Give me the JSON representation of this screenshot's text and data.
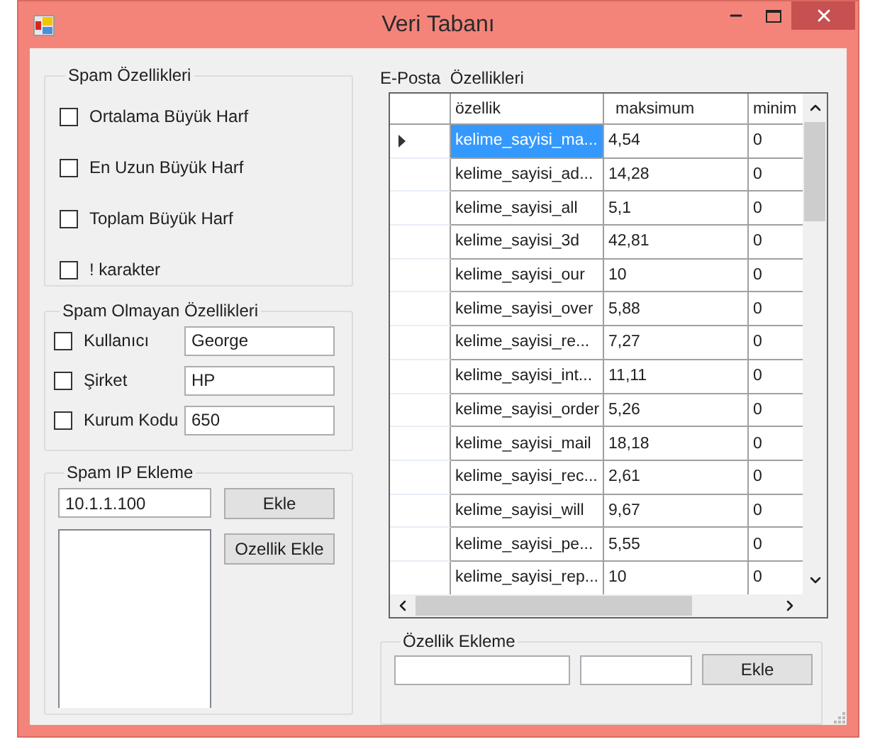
{
  "window": {
    "title": "Veri Tabanı"
  },
  "spam_features": {
    "title": "Spam Özellikleri",
    "options": [
      {
        "label": "Ortalama Büyük Harf",
        "checked": false
      },
      {
        "label": "En Uzun Büyük Harf",
        "checked": false
      },
      {
        "label": "Toplam Büyük Harf",
        "checked": false
      },
      {
        "label": "! karakter",
        "checked": false
      }
    ]
  },
  "non_spam_features": {
    "title": "Spam Olmayan Özellikleri",
    "fields": [
      {
        "label": "Kullanıcı",
        "checked": false,
        "value": "George"
      },
      {
        "label": "Şirket",
        "checked": false,
        "value": "HP"
      },
      {
        "label": "Kurum Kodu",
        "checked": false,
        "value": "650"
      }
    ]
  },
  "spam_ip": {
    "title": "Spam IP Ekleme",
    "value": "10.1.1.100",
    "add_button": "Ekle",
    "feature_button": "Ozellik Ekle"
  },
  "email_features": {
    "title": "E-Posta  Özellikleri",
    "columns": [
      "özellik",
      "maksimum",
      "minim"
    ],
    "rows": [
      {
        "cells": [
          "kelime_sayisi_ma...",
          "4,54",
          "0"
        ],
        "selected": true
      },
      {
        "cells": [
          "kelime_sayisi_ad...",
          "14,28",
          "0"
        ],
        "selected": false
      },
      {
        "cells": [
          "kelime_sayisi_all",
          "5,1",
          "0"
        ],
        "selected": false
      },
      {
        "cells": [
          "kelime_sayisi_3d",
          "42,81",
          "0"
        ],
        "selected": false
      },
      {
        "cells": [
          "kelime_sayisi_our",
          "10",
          "0"
        ],
        "selected": false
      },
      {
        "cells": [
          "kelime_sayisi_over",
          "5,88",
          "0"
        ],
        "selected": false
      },
      {
        "cells": [
          "kelime_sayisi_re...",
          "7,27",
          "0"
        ],
        "selected": false
      },
      {
        "cells": [
          "kelime_sayisi_int...",
          "11,11",
          "0"
        ],
        "selected": false
      },
      {
        "cells": [
          "kelime_sayisi_order",
          "5,26",
          "0"
        ],
        "selected": false
      },
      {
        "cells": [
          "kelime_sayisi_mail",
          "18,18",
          "0"
        ],
        "selected": false
      },
      {
        "cells": [
          "kelime_sayisi_rec...",
          "2,61",
          "0"
        ],
        "selected": false
      },
      {
        "cells": [
          "kelime_sayisi_will",
          "9,67",
          "0"
        ],
        "selected": false
      },
      {
        "cells": [
          "kelime_sayisi_pe...",
          "5,55",
          "0"
        ],
        "selected": false
      },
      {
        "cells": [
          "kelime_sayisi_rep...",
          "10",
          "0"
        ],
        "selected": false
      }
    ]
  },
  "feature_add": {
    "title": "Özellik Ekleme",
    "button": "Ekle"
  }
}
